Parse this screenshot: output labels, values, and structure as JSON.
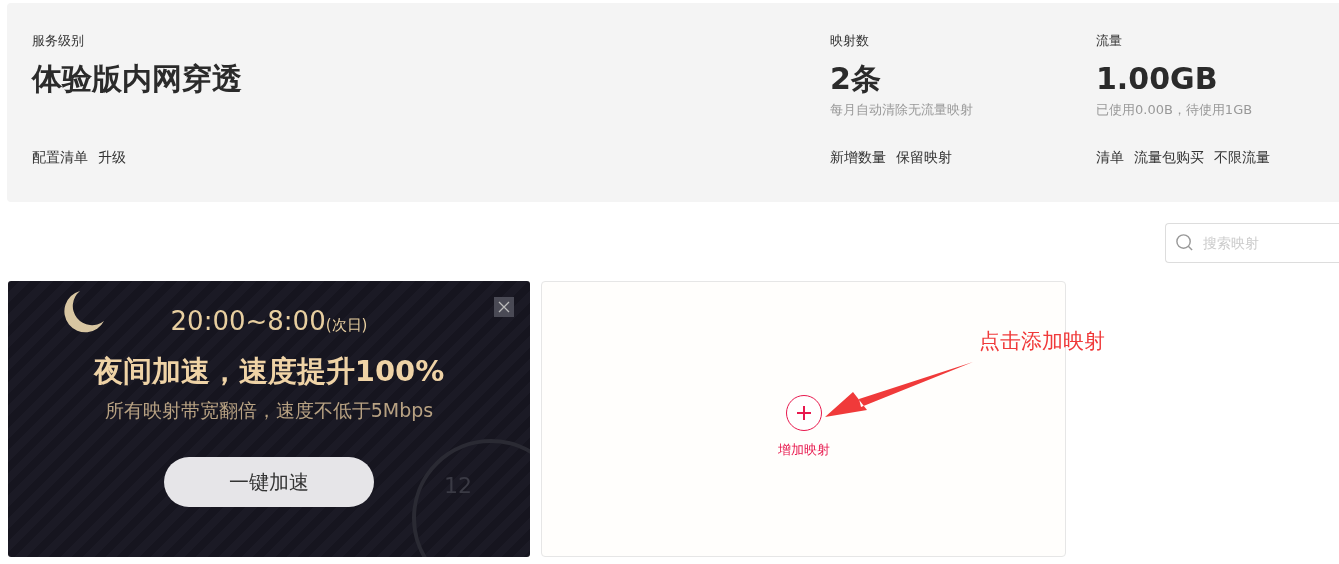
{
  "summary": {
    "columns": [
      {
        "label": "服务级别",
        "value": "体验版内网穿透",
        "links": [
          "配置清单",
          "升级"
        ]
      },
      {
        "label": "映射数",
        "value": "2条",
        "note": "每月自动清除无流量映射",
        "links": [
          "新增数量",
          "保留映射"
        ]
      },
      {
        "label": "流量",
        "value": "1.00GB",
        "note": "已使用0.00B，待使用1GB",
        "links": [
          "清单",
          "流量包购买",
          "不限流量"
        ]
      }
    ]
  },
  "search": {
    "placeholder": "搜索映射"
  },
  "promo": {
    "time": "20:00~8:00",
    "time_suffix": "(次日)",
    "headline": "夜间加速，速度提升100%",
    "subline": "所有映射带宽翻倍，速度不低于5Mbps",
    "button": "一键加速",
    "clock_numeral": "12"
  },
  "add_card": {
    "label": "增加映射"
  },
  "annotation": {
    "text": "点击添加映射"
  }
}
